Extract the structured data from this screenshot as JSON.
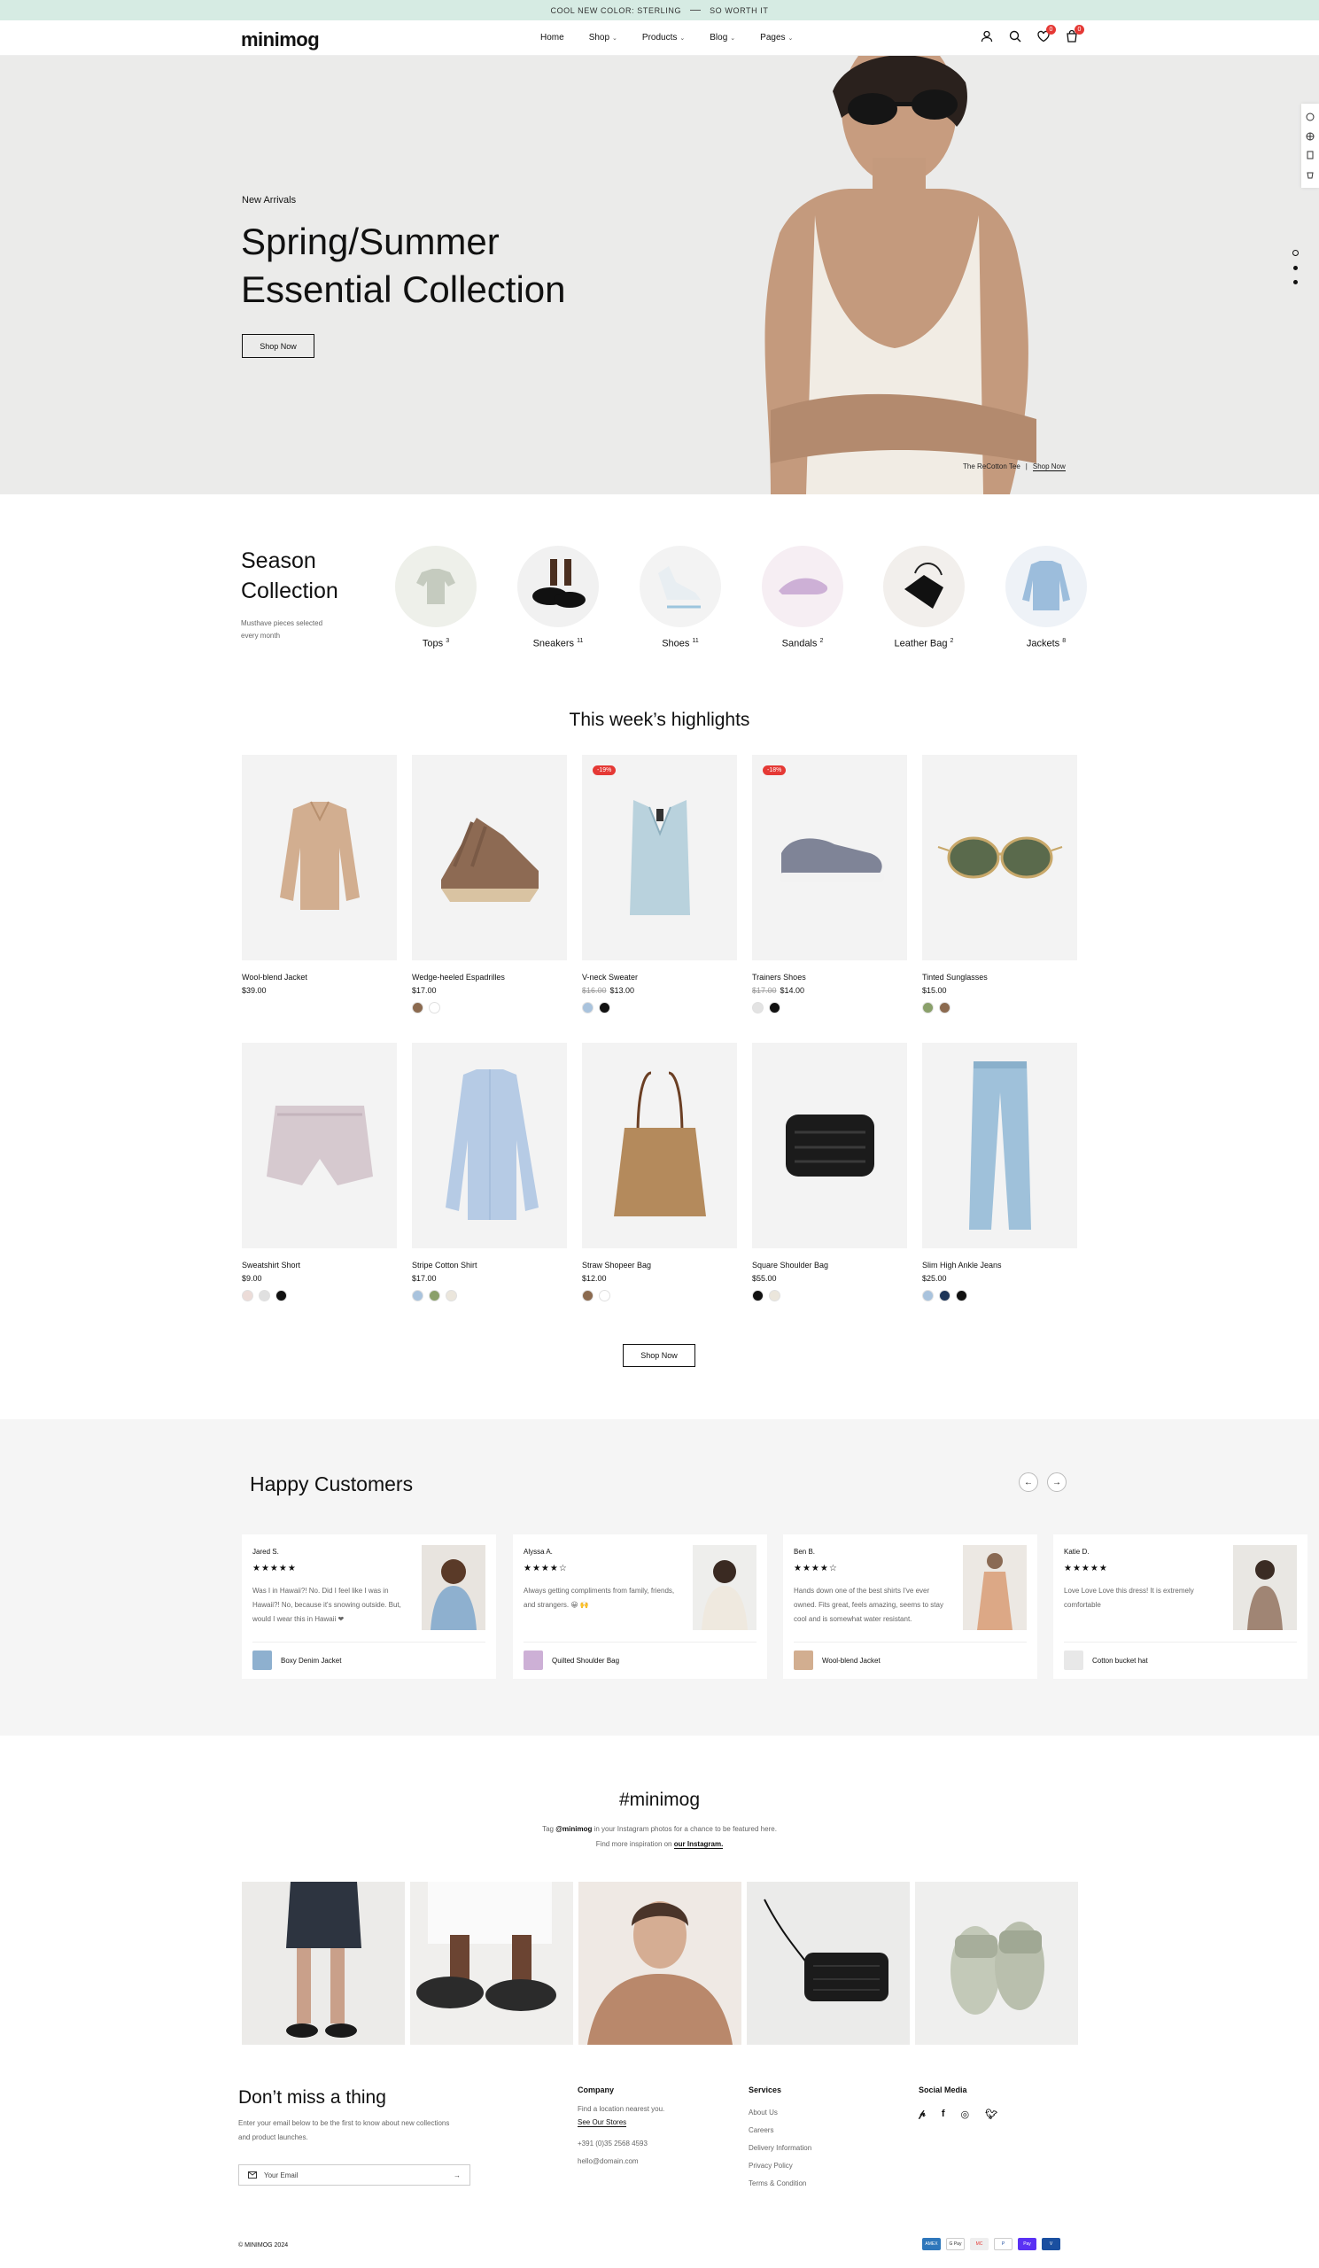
{
  "announcement": {
    "left": "COOL NEW COLOR: STERLING",
    "right": "SO WORTH IT"
  },
  "header": {
    "logo": "minimog",
    "nav": [
      {
        "label": "Home",
        "has_dropdown": false
      },
      {
        "label": "Shop",
        "has_dropdown": true
      },
      {
        "label": "Products",
        "has_dropdown": true
      },
      {
        "label": "Blog",
        "has_dropdown": true
      },
      {
        "label": "Pages",
        "has_dropdown": true
      }
    ],
    "wishlist_count": "0",
    "cart_count": "0"
  },
  "hero": {
    "subtitle": "New Arrivals",
    "title_line1": "Spring/Summer",
    "title_line2": "Essential Collection",
    "button": "Shop Now",
    "caption": "The ReCotton Tee",
    "caption_link": "Shop Now"
  },
  "season": {
    "title_line1": "Season",
    "title_line2": "Collection",
    "description": "Musthave pieces selected every month",
    "categories": [
      {
        "label": "Tops",
        "count": "3",
        "bg": "#eef0ea"
      },
      {
        "label": "Sneakers",
        "count": "11",
        "bg": "#f1f1f1"
      },
      {
        "label": "Shoes",
        "count": "11",
        "bg": "#f3f3f3"
      },
      {
        "label": "Sandals",
        "count": "2",
        "bg": "#f6eef3"
      },
      {
        "label": "Leather Bag",
        "count": "2",
        "bg": "#f2efec"
      },
      {
        "label": "Jackets",
        "count": "8",
        "bg": "#eef2f7"
      }
    ]
  },
  "highlights": {
    "title": "This week’s highlights",
    "button": "Shop Now",
    "products": [
      {
        "name": "Wool-blend Jacket",
        "price": "$39.00",
        "old_price": "",
        "sale": "",
        "swatches": []
      },
      {
        "name": "Wedge-heeled Espadrilles",
        "price": "$17.00",
        "old_price": "",
        "sale": "",
        "swatches": [
          "#8b6a4f",
          "#ffffff"
        ]
      },
      {
        "name": "V-neck Sweater",
        "price": "$13.00",
        "old_price": "$16.00",
        "sale": "-19%",
        "swatches": [
          "#a9c3dd",
          "#111111"
        ]
      },
      {
        "name": "Trainers Shoes",
        "price": "$14.00",
        "old_price": "$17.00",
        "sale": "-18%",
        "swatches": [
          "#e3e3e3",
          "#111111"
        ]
      },
      {
        "name": "Tinted Sunglasses",
        "price": "$15.00",
        "old_price": "",
        "sale": "",
        "swatches": [
          "#8aa06a",
          "#8b6a4f"
        ]
      },
      {
        "name": "Sweatshirt Short",
        "price": "$9.00",
        "old_price": "",
        "sale": "",
        "swatches": [
          "#ecdcd8",
          "#e0e0e0",
          "#111111"
        ]
      },
      {
        "name": "Stripe Cotton Shirt",
        "price": "$17.00",
        "old_price": "",
        "sale": "",
        "swatches": [
          "#a9c3dd",
          "#8aa06a",
          "#ebe6dc"
        ]
      },
      {
        "name": "Straw Shopeer Bag",
        "price": "$12.00",
        "old_price": "",
        "sale": "",
        "swatches": [
          "#8b6a4f",
          "#ffffff"
        ]
      },
      {
        "name": "Square Shoulder Bag",
        "price": "$55.00",
        "old_price": "",
        "sale": "",
        "swatches": [
          "#111111",
          "#ebe6dc"
        ]
      },
      {
        "name": "Slim High Ankle Jeans",
        "price": "$25.00",
        "old_price": "",
        "sale": "",
        "swatches": [
          "#a9c3dd",
          "#1d3557",
          "#111111"
        ]
      }
    ]
  },
  "customers": {
    "title": "Happy Customers",
    "reviews": [
      {
        "name": "Jared S.",
        "stars": "★★★★★",
        "text": "Was I in Hawaii?! No. Did I feel like I was in Hawaii?! No, because it's snowing outside. But, would I wear this in Hawaii ❤",
        "product": "Boxy Denim Jacket"
      },
      {
        "name": "Alyssa A.",
        "stars": "★★★★☆",
        "text": "Always getting compliments from family, friends, and strangers. 😀 🙌",
        "product": "Quilted Shoulder Bag"
      },
      {
        "name": "Ben B.",
        "stars": "★★★★☆",
        "text": "Hands down one of the best shirts I've ever owned. Fits great, feels amazing, seems to stay cool and is somewhat water resistant.",
        "product": "Wool-blend Jacket"
      },
      {
        "name": "Katie D.",
        "stars": "★★★★★",
        "text": "Love Love Love this dress! It is extremely comfortable",
        "product": "Cotton bucket hat"
      }
    ]
  },
  "instagram": {
    "title": "#minimog",
    "line1_pre": "Tag ",
    "line1_handle": "@minimog",
    "line1_post": " in your Instagram photos for a chance to be featured here.",
    "line2_pre": "Find more inspiration on ",
    "line2_link": "our Instagram."
  },
  "footer": {
    "title": "Don’t miss a thing",
    "description": "Enter your email below to be the first to know about new collections and product launches.",
    "email_placeholder": "Your Email",
    "company_heading": "Company",
    "company_text": "Find a location nearest you.",
    "company_link": "See Our Stores",
    "phone": "+391 (0)35 2568 4593",
    "email": "hello@domain.com",
    "services_heading": "Services",
    "services": [
      "About Us",
      "Careers",
      "Delivery Information",
      "Privacy Policy",
      "Terms & Condition"
    ],
    "social_heading": "Social Media",
    "copyright": "© MINIMOG 2024",
    "payments": [
      "AMEX",
      "G Pay",
      "MC",
      "P",
      "Pay",
      "V"
    ]
  }
}
